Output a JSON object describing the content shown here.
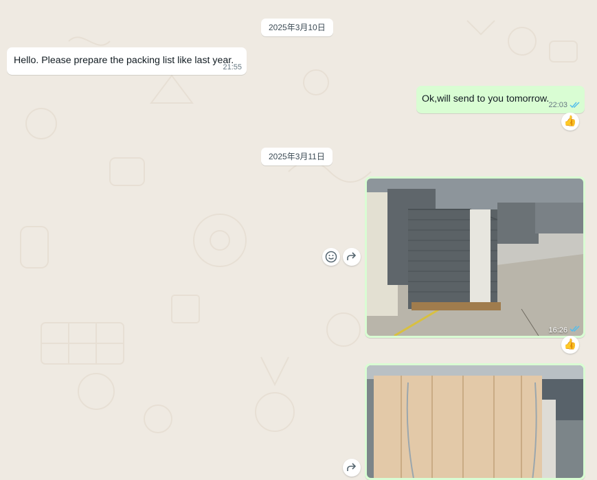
{
  "chat": {
    "date_1": "2025年3月10日",
    "date_2": "2025年3月11日",
    "messages": [
      {
        "direction": "incoming",
        "text": "Hello. Please prepare the packing list like last year.",
        "time": "21:55"
      },
      {
        "direction": "outgoing",
        "text": "Ok,will send to you tomorrow.",
        "time": "22:03",
        "status": "read",
        "reaction": "👍"
      },
      {
        "direction": "outgoing",
        "type": "image",
        "image_icon": "warehouse-photo",
        "time": "16:26",
        "status": "read",
        "reaction": "👍"
      },
      {
        "direction": "outgoing",
        "type": "image",
        "image_icon": "wooden-crate-photo"
      }
    ]
  },
  "colors": {
    "background": "#efeae2",
    "incoming_bubble": "#ffffff",
    "outgoing_bubble": "#d9fdd3",
    "read_ticks": "#53bdeb"
  },
  "icons": {
    "emoji_react": "emoji-icon",
    "forward": "forward-icon"
  }
}
